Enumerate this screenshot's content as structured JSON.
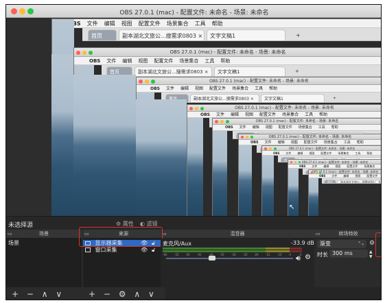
{
  "window": {
    "title": "OBS 27.0.1 (mac) - 配置文件: 未命名 - 场景: 未命名",
    "traffic_lights": [
      "#fe5f57",
      "#febc2e",
      "#28c840"
    ]
  },
  "nested_menu": {
    "apple": "",
    "items": [
      "OBS",
      "文件",
      "编辑",
      "视图",
      "配置文件",
      "场景集合",
      "工具",
      "帮助"
    ]
  },
  "browser_tabs": {
    "home": "首页",
    "doc1": "副本湖北文旅公...搜需求0803",
    "doc2": "文字文稿1",
    "close": "×",
    "plus": "+"
  },
  "toolbar": {
    "no_source": "未选择源",
    "properties": "属性",
    "filters": "滤镜"
  },
  "docks": {
    "scenes": {
      "title": "场景",
      "items": [
        "场景"
      ]
    },
    "sources": {
      "title": "来源",
      "items": [
        {
          "label": "显示器采集",
          "icon": "monitor-icon"
        },
        {
          "label": "窗口采集",
          "icon": "window-icon"
        }
      ]
    },
    "mixer": {
      "title": "混音器",
      "channel": "麦克风/Aux",
      "level": "-33.9 dB",
      "scale": [
        "-60",
        "-55",
        "-50",
        "-45",
        "-40",
        "-35",
        "-30",
        "-25",
        "-20",
        "-15",
        "-10",
        "-5",
        "0"
      ]
    },
    "transitions": {
      "title": "转场特效",
      "type": "渐变",
      "duration_label": "时长",
      "duration_value": "300 ms"
    }
  },
  "footer": {
    "scenes": [
      "+",
      "−",
      "∧",
      "∨"
    ],
    "sources": [
      "+",
      "−",
      "⚙",
      "∧",
      "∨"
    ]
  },
  "colors": {
    "highlight_red": "#e0302a",
    "selected_blue": "#2f69c4"
  }
}
